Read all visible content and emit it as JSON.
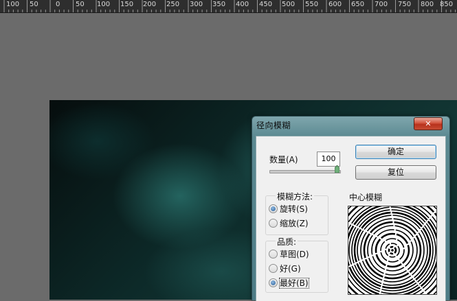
{
  "ruler": {
    "labels": [
      "100",
      "50",
      "0",
      "50",
      "100",
      "150",
      "200",
      "250",
      "300",
      "350",
      "400",
      "450",
      "500",
      "550",
      "600",
      "650",
      "700",
      "750",
      "800",
      "850"
    ]
  },
  "dialog": {
    "title": "径向模糊",
    "close_glyph": "✕",
    "amount_label": "数量(A)",
    "amount_value": "100",
    "amount_level": 1.0,
    "ok_label": "确定",
    "reset_label": "复位",
    "method": {
      "title": "模糊方法:",
      "options": [
        "旋转(S)",
        "缩放(Z)"
      ],
      "selected": 0
    },
    "quality": {
      "title": "品质:",
      "options": [
        "草图(D)",
        "好(G)",
        "最好(B)"
      ],
      "selected": 2
    },
    "center_label": "中心模糊"
  },
  "colors": {
    "ruler_bg": "#2e2e2e",
    "workspace_bg": "#6b6b6b",
    "title_bar": "#5b8991",
    "close_red": "#c64c33",
    "dialog_bg": "#f0f0f0"
  },
  "icons": [
    "close-icon",
    "slider-thumb-icon",
    "radio-icon"
  ]
}
